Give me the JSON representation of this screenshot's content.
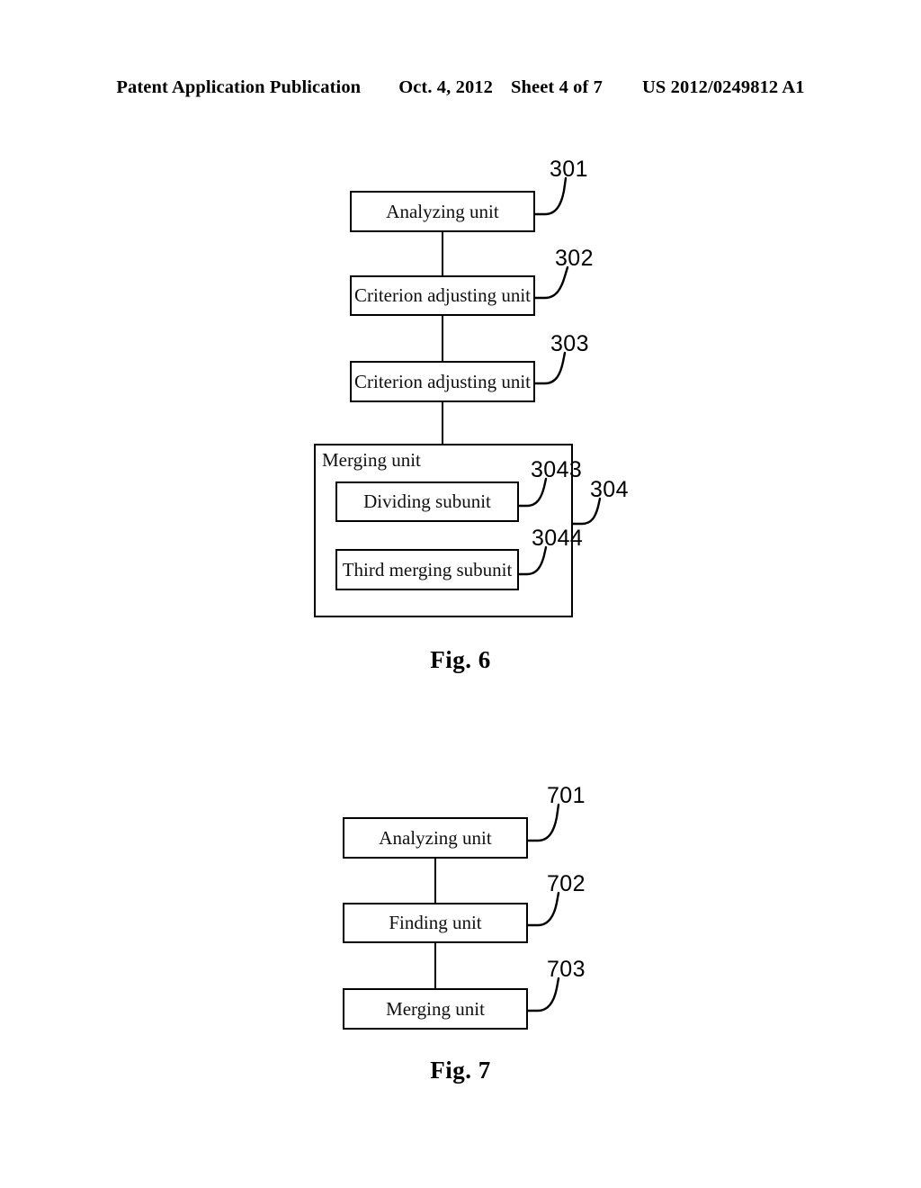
{
  "header": {
    "publication": "Patent Application Publication",
    "date": "Oct. 4, 2012",
    "sheet": "Sheet 4 of 7",
    "number": "US 2012/0249812 A1"
  },
  "figures": [
    {
      "caption": "Fig. 6",
      "boxes": [
        {
          "label": "Analyzing unit",
          "ref": "301"
        },
        {
          "label": "Criterion adjusting unit",
          "ref": "302"
        },
        {
          "label": "Criterion adjusting unit",
          "ref": "303"
        }
      ],
      "group": {
        "label": "Merging unit",
        "ref": "304",
        "subunits": [
          {
            "label": "Dividing subunit",
            "ref": "3043"
          },
          {
            "label": "Third merging subunit",
            "ref": "3044"
          }
        ]
      }
    },
    {
      "caption": "Fig. 7",
      "boxes": [
        {
          "label": "Analyzing unit",
          "ref": "701"
        },
        {
          "label": "Finding unit",
          "ref": "702"
        },
        {
          "label": "Merging unit",
          "ref": "703"
        }
      ]
    }
  ]
}
